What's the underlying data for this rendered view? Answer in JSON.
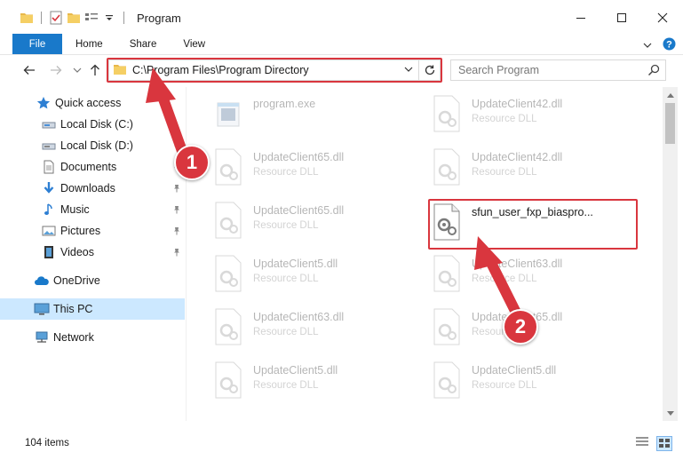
{
  "window": {
    "title": "Program",
    "minimize_glyph": "─",
    "maximize_glyph": "☐",
    "close_glyph": "✕"
  },
  "ribbon": {
    "tabs": [
      {
        "label": "File",
        "active": true
      },
      {
        "label": "Home"
      },
      {
        "label": "Share"
      },
      {
        "label": "View"
      }
    ],
    "accent_color": "#1979ca"
  },
  "address_bar": {
    "path": "C:\\Program Files\\Program Directory",
    "refresh_glyph": "↻",
    "dropdown_glyph": "⌄"
  },
  "search": {
    "placeholder": "Search Program"
  },
  "sidebar": {
    "items": [
      {
        "label": "Quick access",
        "icon": "star-icon",
        "pinned": false
      },
      {
        "label": "Local Disk (C:)",
        "icon": "drive-icon",
        "pinned": false
      },
      {
        "label": "Local Disk (D:)",
        "icon": "drive-icon",
        "pinned": true
      },
      {
        "label": "Documents",
        "icon": "documents-icon",
        "pinned": true
      },
      {
        "label": "Downloads",
        "icon": "download-icon",
        "pinned": true
      },
      {
        "label": "Music",
        "icon": "music-icon",
        "pinned": true
      },
      {
        "label": "Pictures",
        "icon": "pictures-icon",
        "pinned": true
      },
      {
        "label": "Videos",
        "icon": "videos-icon",
        "pinned": true
      },
      {
        "label": "OneDrive",
        "icon": "cloud-icon",
        "pinned": false
      },
      {
        "label": "This PC",
        "icon": "pc-icon",
        "pinned": false,
        "selected": true
      },
      {
        "label": "Network",
        "icon": "network-icon",
        "pinned": false
      }
    ]
  },
  "files": [
    {
      "name": "program.exe",
      "type": "",
      "faded": true,
      "icon": "exe-icon"
    },
    {
      "name": "UpdateClient42.dll",
      "type": "Resource DLL",
      "faded": true,
      "icon": "dll-icon"
    },
    {
      "name": "UpdateClient65.dll",
      "type": "Resource DLL",
      "faded": true,
      "icon": "dll-icon"
    },
    {
      "name": "UpdateClient42.dll",
      "type": "Resource DLL",
      "faded": true,
      "icon": "dll-icon"
    },
    {
      "name": "UpdateClient65.dll",
      "type": "Resource DLL",
      "faded": true,
      "icon": "dll-icon"
    },
    {
      "name": "sfun_user_fxp_biaspro...",
      "type": "",
      "faded": false,
      "icon": "dll-icon",
      "highlighted": true
    },
    {
      "name": "UpdateClient5.dll",
      "type": "Resource DLL",
      "faded": true,
      "icon": "dll-icon"
    },
    {
      "name": "UpdateClient63.dll",
      "type": "Resource DLL",
      "faded": true,
      "icon": "dll-icon"
    },
    {
      "name": "UpdateClient63.dll",
      "type": "Resource DLL",
      "faded": true,
      "icon": "dll-icon"
    },
    {
      "name": "UpdateClient65.dll",
      "type": "Resource DLL",
      "faded": true,
      "icon": "dll-icon"
    },
    {
      "name": "UpdateClient5.dll",
      "type": "Resource DLL",
      "faded": true,
      "icon": "dll-icon"
    },
    {
      "name": "UpdateClient5.dll",
      "type": "Resource DLL",
      "faded": true,
      "icon": "dll-icon"
    }
  ],
  "status": {
    "item_count": "104 items"
  },
  "annotations": {
    "step1": "1",
    "step2": "2",
    "color": "#d9363e"
  }
}
